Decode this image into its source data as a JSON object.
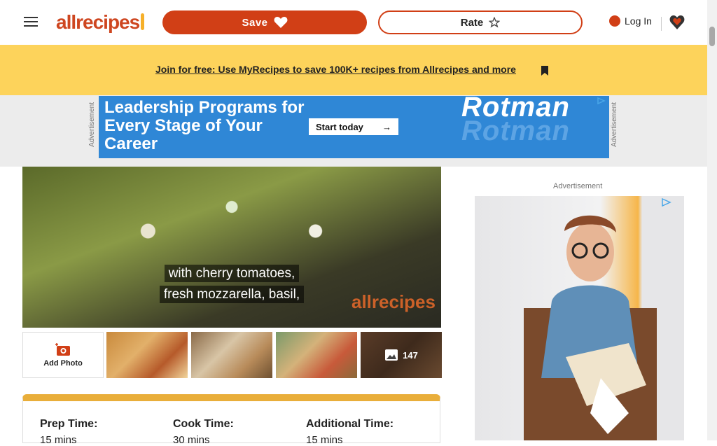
{
  "header": {
    "logo_text": "allrecipes",
    "save_label": "Save",
    "rate_label": "Rate",
    "login_label": "Log In"
  },
  "promo": {
    "text": "Join for free: Use MyRecipes to save 100K+ recipes from Allrecipes and more"
  },
  "ad_top": {
    "label": "Advertisement",
    "headline": "Leadership Programs for Every Stage of Your Career",
    "cta": "Start today",
    "brand": "Rotman"
  },
  "video": {
    "caption_line1": "with cherry tomatoes,",
    "caption_line2": "fresh mozzarella, basil,",
    "watermark": "allrecipes"
  },
  "gallery": {
    "add_photo_label": "Add Photo",
    "photo_count": "147"
  },
  "details": {
    "prep_label": "Prep Time:",
    "prep_value": "15 mins",
    "cook_label": "Cook Time:",
    "cook_value": "30 mins",
    "additional_label": "Additional Time:",
    "additional_value": "15 mins"
  },
  "ad_right": {
    "label": "Advertisement"
  },
  "colors": {
    "brand": "#ce4620",
    "save_button": "#d13f16",
    "promo_band": "#fdd35b",
    "ad_banner": "#2f87d6",
    "details_accent": "#e9ae3a"
  },
  "icons": [
    "menu-icon",
    "heart-icon",
    "star-icon",
    "user-icon",
    "bookmark-icon",
    "camera-icon",
    "gallery-icon",
    "ad-choices-icon"
  ]
}
